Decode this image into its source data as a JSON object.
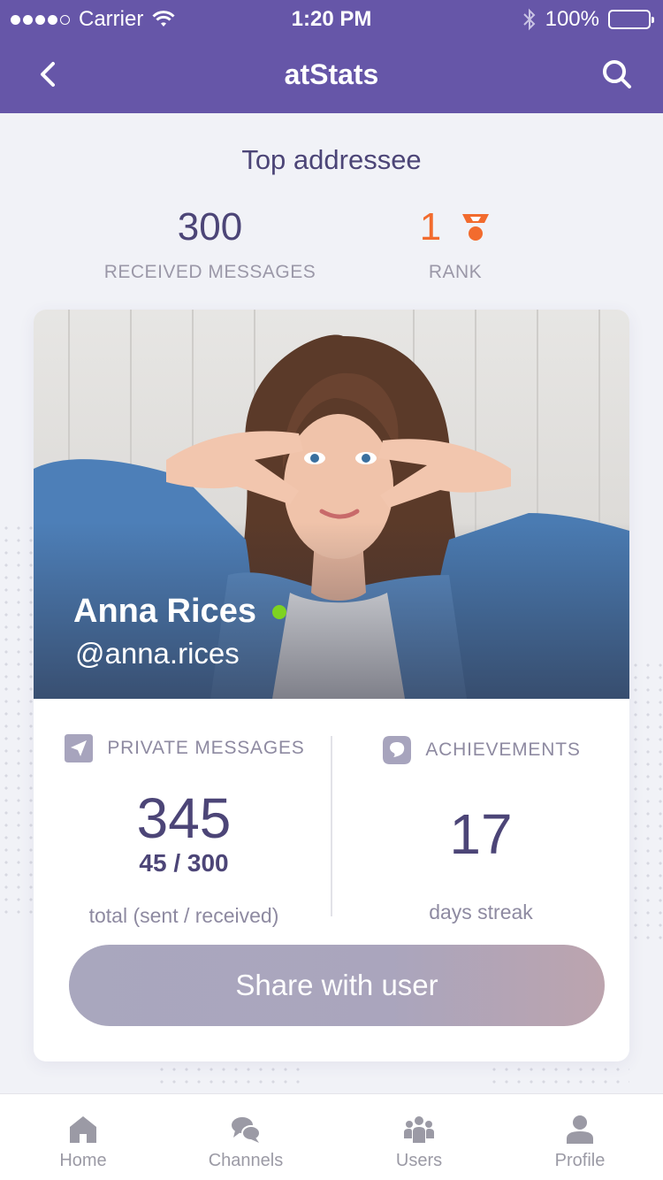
{
  "status_bar": {
    "carrier": "Carrier",
    "time": "1:20 PM",
    "battery": "100%"
  },
  "nav": {
    "title": "atStats",
    "back_icon": "chevron-left-icon",
    "search_icon": "search-icon"
  },
  "header": {
    "title": "Top addressee",
    "received": {
      "value": "300",
      "label": "RECEIVED MESSAGES"
    },
    "rank": {
      "value": "1",
      "label": "RANK",
      "icon": "medal-icon"
    }
  },
  "profile": {
    "name": "Anna Rices",
    "handle": "@anna.rices",
    "online": true
  },
  "stats": {
    "private": {
      "label": "PRIVATE MESSAGES",
      "icon": "send-icon",
      "total": "345",
      "split": "45 / 300",
      "caption": "total (sent / received)"
    },
    "achievements": {
      "label": "ACHIEVEMENTS",
      "icon": "badge-icon",
      "value": "17",
      "caption": "days streak"
    }
  },
  "share_button": {
    "label": "Share with user"
  },
  "tabs": [
    {
      "label": "Home",
      "icon": "home-icon"
    },
    {
      "label": "Channels",
      "icon": "chat-bubbles-icon"
    },
    {
      "label": "Users",
      "icon": "users-icon"
    },
    {
      "label": "Profile",
      "icon": "person-icon"
    }
  ],
  "colors": {
    "brand": "#6656A8",
    "accent": "#F26B2E",
    "text": "#4C4577",
    "online": "#7ED321"
  }
}
